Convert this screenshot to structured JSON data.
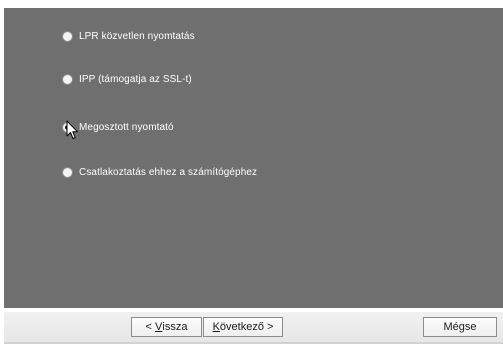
{
  "options": [
    {
      "label": "LPR közvetlen nyomtatás",
      "checked": false
    },
    {
      "label": "IPP (támogatja az SSL-t)",
      "checked": false
    },
    {
      "label": "Megosztott nyomtató",
      "checked": true
    },
    {
      "label": "Csatlakoztatás ehhez a számítógéphez",
      "checked": false
    }
  ],
  "buttons": {
    "back": {
      "prefix": "< ",
      "mnemonic": "V",
      "rest": "issza"
    },
    "next": {
      "mnemonic": "K",
      "rest": "övetkező",
      "suffix": " >"
    },
    "cancel": "Mégse"
  }
}
